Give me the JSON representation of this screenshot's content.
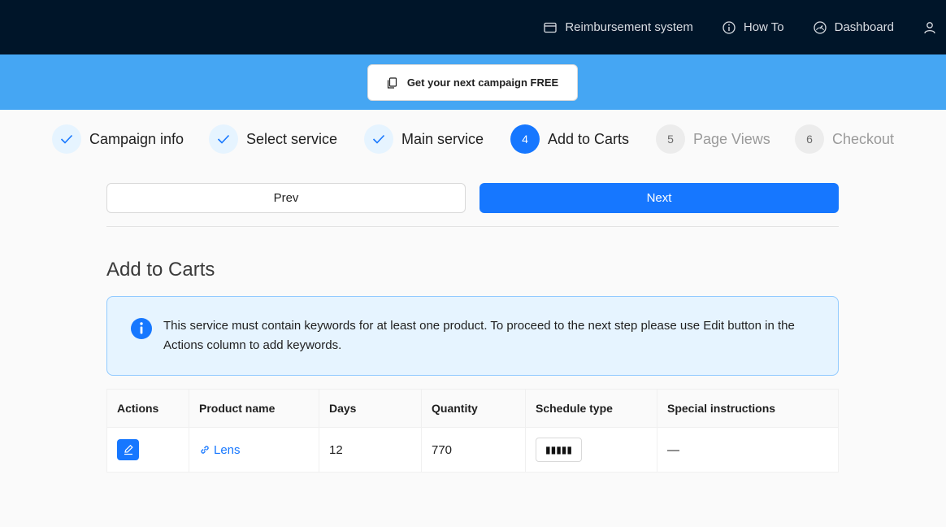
{
  "topnav": {
    "items": [
      {
        "label": "Reimbursement system",
        "icon": "card-icon"
      },
      {
        "label": "How To",
        "icon": "info-circle-icon"
      },
      {
        "label": "Dashboard",
        "icon": "dashboard-icon"
      },
      {
        "label": "",
        "icon": "user-icon"
      }
    ]
  },
  "banner": {
    "promo_label": "Get your next campaign FREE"
  },
  "steps": [
    {
      "label": "Campaign info",
      "status": "done"
    },
    {
      "label": "Select service",
      "status": "done"
    },
    {
      "label": "Main service",
      "status": "done"
    },
    {
      "number": "4",
      "label": "Add to Carts",
      "status": "active"
    },
    {
      "number": "5",
      "label": "Page Views",
      "status": "wait"
    },
    {
      "number": "6",
      "label": "Checkout",
      "status": "wait"
    }
  ],
  "actions": {
    "prev_label": "Prev",
    "next_label": "Next"
  },
  "section": {
    "title": "Add to Carts"
  },
  "alert": {
    "text": "This service must contain keywords for at least one product. To proceed to the next step please use Edit button in the Actions column to add keywords."
  },
  "table": {
    "headers": [
      "Actions",
      "Product name",
      "Days",
      "Quantity",
      "Schedule type",
      "Special instructions"
    ],
    "rows": [
      {
        "product": "Lens",
        "days": "12",
        "quantity": "770",
        "schedule": "▮▮▮▮▮",
        "instructions": "—"
      }
    ]
  },
  "colors": {
    "primary": "#1677ff",
    "header_bg": "#001529",
    "banner_bg": "#45a6f3",
    "alert_bg": "#e6f4ff"
  }
}
